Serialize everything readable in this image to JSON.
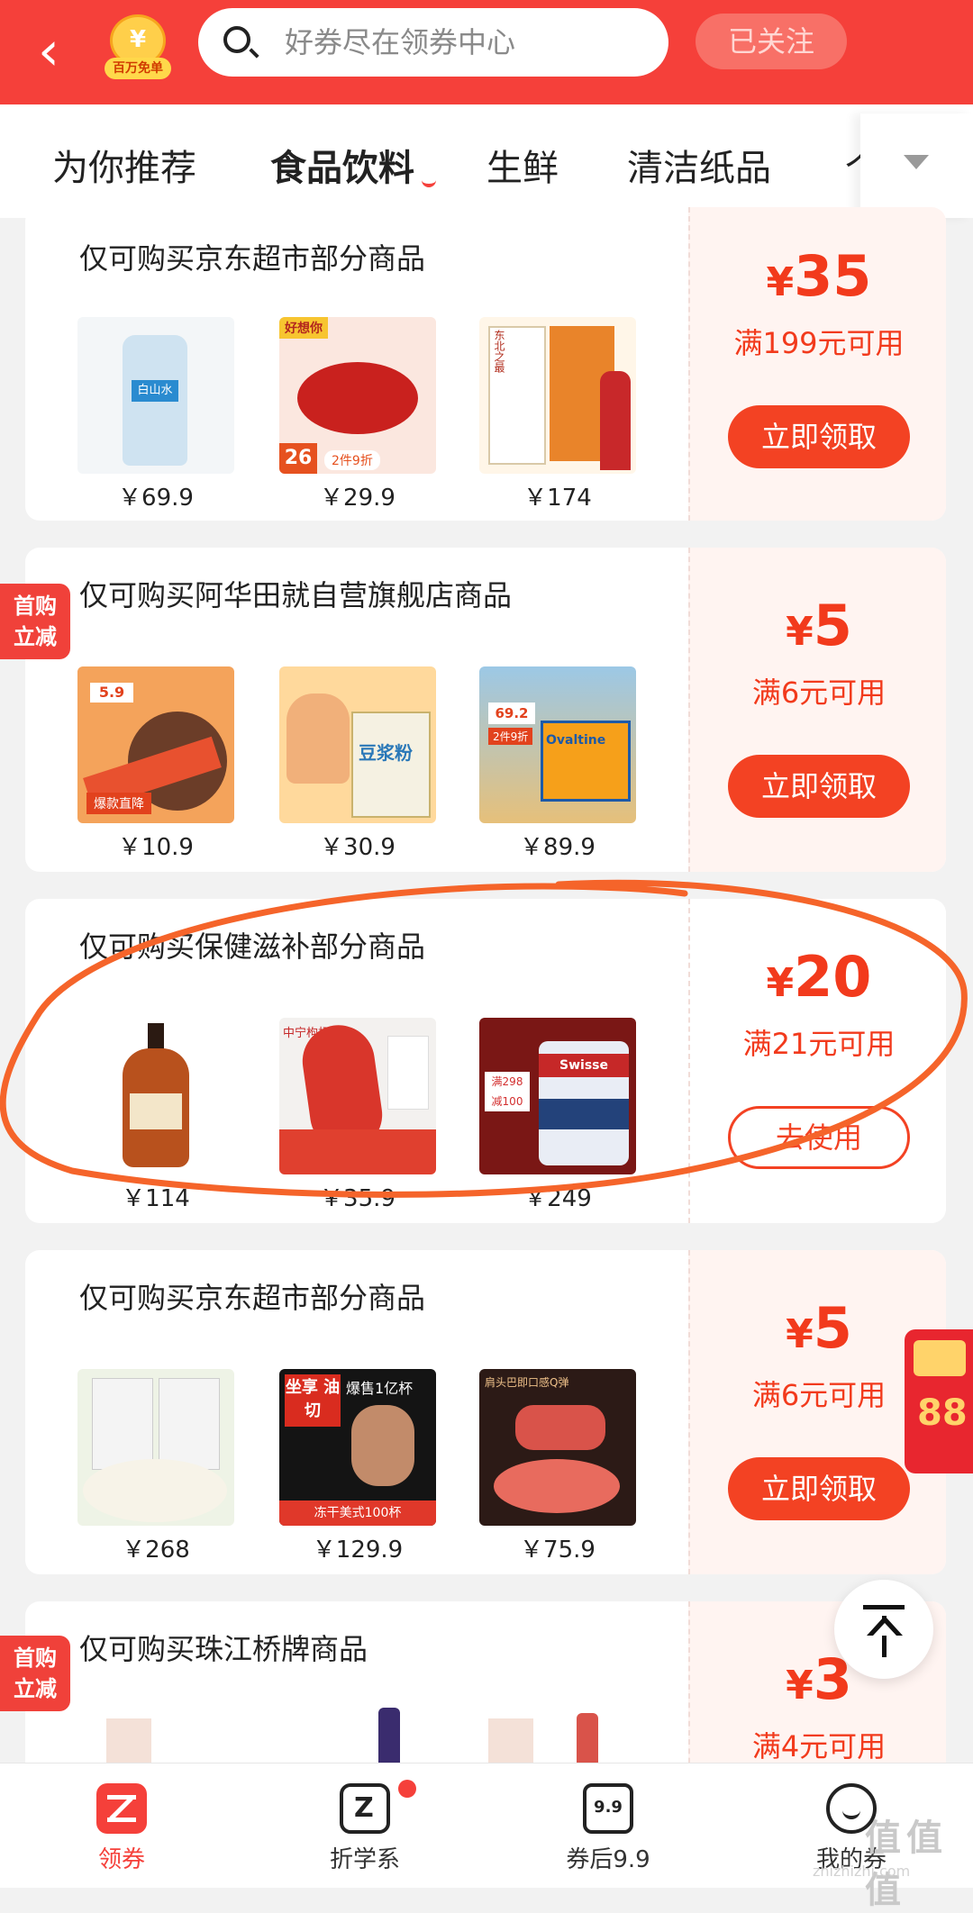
{
  "header": {
    "back_glyph": "‹",
    "badge_label": "百万免单",
    "search_placeholder": "好券尽在领券中心",
    "follow_label": "已关注"
  },
  "tabs": [
    "为你推荐",
    "食品饮料",
    "生鲜",
    "清洁纸品",
    "个"
  ],
  "active_tab": "食品饮料",
  "coupons": [
    {
      "title": "仅可购买京东超市部分商品",
      "amount": "35",
      "condition": "满199元可用",
      "button": "立即领取",
      "products": [
        {
          "price": "￥69.9",
          "label": "白山水"
        },
        {
          "price": "￥29.9",
          "label": "好想你",
          "badge": "26",
          "sub": "2件9折"
        },
        {
          "price": "￥174",
          "label": "东北之最"
        }
      ]
    },
    {
      "title": "仅可购买阿华田就自营旗舰店商品",
      "first_tag": [
        "首购",
        "立减"
      ],
      "amount": "5",
      "condition": "满6元可用",
      "button": "立即领取",
      "products": [
        {
          "price": "￥10.9",
          "badge": "5.9",
          "sub": "爆款直降"
        },
        {
          "price": "￥30.9",
          "label": "豆浆粉"
        },
        {
          "price": "￥89.9",
          "badge": "69.2",
          "sub": "2件9折",
          "label": "Ovaltine"
        }
      ]
    },
    {
      "title": "仅可购买保健滋补部分商品",
      "amount": "20",
      "condition": "满21元可用",
      "button": "去使用",
      "products": [
        {
          "price": "￥114"
        },
        {
          "price": "￥35.9",
          "label": "中宁枸杞"
        },
        {
          "price": "￥249",
          "label": "Swisse",
          "sub": "满298 减100"
        }
      ]
    },
    {
      "title": "仅可购买京东超市部分商品",
      "amount": "5",
      "condition": "满6元可用",
      "button": "立即领取",
      "products": [
        {
          "price": "￥268"
        },
        {
          "price": "￥129.9",
          "label": "坐享 油切",
          "sub": "爆售1亿杯",
          "badge": "冻干美式100杯"
        },
        {
          "price": "￥75.9",
          "label": "肩头巴即口感Q弹"
        }
      ]
    },
    {
      "title": "仅可购买珠江桥牌商品",
      "first_tag": [
        "首购",
        "立减"
      ],
      "amount": "3",
      "condition": "满4元可用",
      "button": "立即领取",
      "products": []
    }
  ],
  "floating": {
    "hongbao_text": "88",
    "top_icon": "arrow-up-to-top-icon"
  },
  "nav": [
    {
      "label": "领券",
      "icon": "coupon-z-icon",
      "active": true
    },
    {
      "label": "折学系",
      "icon": "z-box-icon",
      "dot": true
    },
    {
      "label": "券后9.9",
      "icon": "nine-nine-icon",
      "icon_text": "9.9"
    },
    {
      "label": "我的券",
      "icon": "smile-face-icon"
    }
  ],
  "watermark": {
    "text": "值值值",
    "url": "zhizhizhi.com"
  },
  "colors": {
    "brand_red": "#f5403a",
    "coupon_red": "#f23a1c",
    "annotation_orange": "#f5642a"
  }
}
